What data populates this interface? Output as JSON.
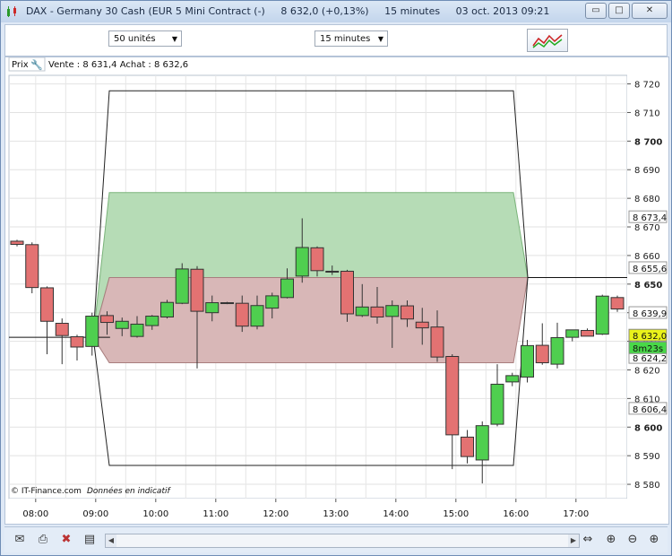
{
  "window": {
    "title_instrument": "DAX - Germany 30 Cash (EUR 5 Mini Contract (-)",
    "title_price": "8 632,0 (+0,13%)",
    "title_interval": "15 minutes",
    "title_datetime": "03 oct. 2013 09:21",
    "minimize_label": "▭",
    "restore_label": "□",
    "close_label": "✕"
  },
  "toolbar": {
    "units_select": "50 unités",
    "interval_select": "15 minutes"
  },
  "chart_header": {
    "prix_label": "Prix",
    "vente_achat": "Vente : 8 631,4 Achat : 8 632,6"
  },
  "footer": {
    "copyright": "© IT-Finance.com",
    "disclaimer": "Données en indicatif"
  },
  "colors": {
    "bull": "#4fcf4f",
    "bear": "#e37272",
    "green_zone": "#b6dcb6",
    "red_zone": "#d8b7b7",
    "price_tag": "#eaf21a",
    "timer_tag": "#48d848"
  },
  "chart_data": {
    "type": "candlestick",
    "y_range": [
      8575,
      8723
    ],
    "y_ticks": [
      {
        "value": 8720,
        "label": "8 720",
        "bold": false
      },
      {
        "value": 8710,
        "label": "8 710",
        "bold": false
      },
      {
        "value": 8700,
        "label": "8 700",
        "bold": true
      },
      {
        "value": 8690,
        "label": "8 690",
        "bold": false
      },
      {
        "value": 8680,
        "label": "8 680",
        "bold": false
      },
      {
        "value": 8670,
        "label": "8 670",
        "bold": false
      },
      {
        "value": 8660,
        "label": "8 660",
        "bold": false
      },
      {
        "value": 8650,
        "label": "8 650",
        "bold": true
      },
      {
        "value": 8640,
        "label": "8 640",
        "bold": false
      },
      {
        "value": 8630,
        "label": "8 630",
        "bold": false
      },
      {
        "value": 8620,
        "label": "8 620",
        "bold": false
      },
      {
        "value": 8610,
        "label": "8 610",
        "bold": false
      },
      {
        "value": 8600,
        "label": "8 600",
        "bold": true
      },
      {
        "value": 8590,
        "label": "8 590",
        "bold": false
      },
      {
        "value": 8580,
        "label": "8 580",
        "bold": false
      }
    ],
    "level_labels": [
      {
        "value": 8673.4,
        "label": "8 673,4"
      },
      {
        "value": 8655.6,
        "label": "8 655,6"
      },
      {
        "value": 8639.9,
        "label": "8 639,9"
      },
      {
        "value": 8624.2,
        "label": "8 624,2"
      },
      {
        "value": 8606.4,
        "label": "8 606,4"
      }
    ],
    "current_price": {
      "value": 8632.0,
      "label": "8 632,0"
    },
    "timer_label": "8m23s",
    "x_labels": [
      "08:00",
      "09:00",
      "10:00",
      "11:00",
      "12:00",
      "13:00",
      "14:00",
      "15:00",
      "16:00",
      "17:00"
    ],
    "horizontal_lines": [
      8631.4,
      8652.3
    ],
    "zones": [
      {
        "name": "upper",
        "top": 8682.0,
        "bottom": 8652.3
      },
      {
        "name": "lower",
        "top": 8652.3,
        "bottom": 8622.5
      },
      {
        "name": "outer",
        "top": 8717.6,
        "bottom": 8586.6
      }
    ],
    "candles": [
      {
        "o": 8665.0,
        "h": 8665.5,
        "l": 8663.2,
        "c": 8663.9
      },
      {
        "o": 8663.8,
        "h": 8664.6,
        "l": 8646.8,
        "c": 8648.8
      },
      {
        "o": 8648.7,
        "h": 8649.2,
        "l": 8625.5,
        "c": 8637.0
      },
      {
        "o": 8636.3,
        "h": 8638.0,
        "l": 8622.0,
        "c": 8632.0
      },
      {
        "o": 8631.6,
        "h": 8632.3,
        "l": 8623.3,
        "c": 8628.0
      },
      {
        "o": 8628.2,
        "h": 8640.0,
        "l": 8625.0,
        "c": 8638.8
      },
      {
        "o": 8639.0,
        "h": 8640.5,
        "l": 8632.3,
        "c": 8636.6
      },
      {
        "o": 8634.5,
        "h": 8638.3,
        "l": 8631.8,
        "c": 8637.0
      },
      {
        "o": 8631.7,
        "h": 8638.8,
        "l": 8631.3,
        "c": 8636.0
      },
      {
        "o": 8635.5,
        "h": 8639.2,
        "l": 8634.0,
        "c": 8638.8
      },
      {
        "o": 8638.5,
        "h": 8644.5,
        "l": 8638.0,
        "c": 8643.6
      },
      {
        "o": 8643.3,
        "h": 8657.3,
        "l": 8643.0,
        "c": 8655.3
      },
      {
        "o": 8655.2,
        "h": 8656.3,
        "l": 8620.5,
        "c": 8640.5
      },
      {
        "o": 8640.0,
        "h": 8646.0,
        "l": 8637.0,
        "c": 8643.5
      },
      {
        "o": 8643.5,
        "h": 8643.8,
        "l": 8643.0,
        "c": 8643.3
      },
      {
        "o": 8643.3,
        "h": 8646.0,
        "l": 8633.3,
        "c": 8635.3
      },
      {
        "o": 8635.3,
        "h": 8646.0,
        "l": 8634.2,
        "c": 8642.5
      },
      {
        "o": 8641.6,
        "h": 8647.0,
        "l": 8638.0,
        "c": 8645.9
      },
      {
        "o": 8645.3,
        "h": 8655.5,
        "l": 8645.0,
        "c": 8651.8
      },
      {
        "o": 8652.8,
        "h": 8673.0,
        "l": 8650.5,
        "c": 8662.8
      },
      {
        "o": 8662.7,
        "h": 8663.2,
        "l": 8652.7,
        "c": 8654.7
      },
      {
        "o": 8654.3,
        "h": 8656.5,
        "l": 8653.2,
        "c": 8654.5
      },
      {
        "o": 8654.5,
        "h": 8655.0,
        "l": 8636.8,
        "c": 8639.6
      },
      {
        "o": 8639.0,
        "h": 8650.0,
        "l": 8638.5,
        "c": 8642.0
      },
      {
        "o": 8642.0,
        "h": 8649.0,
        "l": 8636.2,
        "c": 8638.5
      },
      {
        "o": 8638.7,
        "h": 8644.3,
        "l": 8627.7,
        "c": 8642.5
      },
      {
        "o": 8642.4,
        "h": 8644.3,
        "l": 8635.0,
        "c": 8637.8
      },
      {
        "o": 8636.7,
        "h": 8641.7,
        "l": 8628.8,
        "c": 8634.7
      },
      {
        "o": 8635.0,
        "h": 8640.8,
        "l": 8622.8,
        "c": 8624.5
      },
      {
        "o": 8624.7,
        "h": 8625.5,
        "l": 8585.3,
        "c": 8597.3
      },
      {
        "o": 8596.5,
        "h": 8599.0,
        "l": 8587.3,
        "c": 8589.7
      },
      {
        "o": 8588.5,
        "h": 8602.0,
        "l": 8580.3,
        "c": 8600.5
      },
      {
        "o": 8601.0,
        "h": 8622.0,
        "l": 8600.3,
        "c": 8615.0
      },
      {
        "o": 8615.8,
        "h": 8619.0,
        "l": 8614.3,
        "c": 8618.0
      },
      {
        "o": 8617.5,
        "h": 8630.5,
        "l": 8615.6,
        "c": 8628.5
      },
      {
        "o": 8628.6,
        "h": 8636.3,
        "l": 8621.8,
        "c": 8622.5
      },
      {
        "o": 8622.0,
        "h": 8636.5,
        "l": 8620.5,
        "c": 8631.3
      },
      {
        "o": 8631.4,
        "h": 8633.8,
        "l": 8630.0,
        "c": 8634.0
      },
      {
        "o": 8633.8,
        "h": 8634.5,
        "l": 8631.8,
        "c": 8631.8
      },
      {
        "o": 8632.5,
        "h": 8646.3,
        "l": 8632.2,
        "c": 8645.8
      },
      {
        "o": 8645.3,
        "h": 8646.0,
        "l": 8640.3,
        "c": 8641.3
      }
    ]
  }
}
